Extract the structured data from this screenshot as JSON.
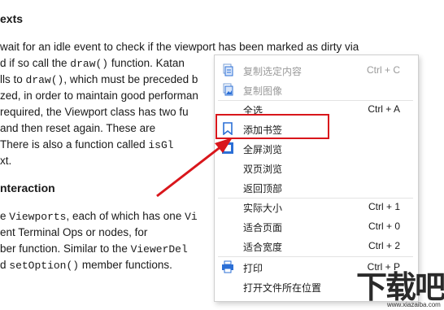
{
  "document": {
    "heading1": "exts",
    "para1": [
      " wait for an idle event to check if the viewport has been marked as dirty via",
      "d if so call the ",
      "draw()",
      " function. Katan",
      "lls to ",
      "draw()",
      ", which must be preceded b",
      "zed, in order to maintain good performan",
      " required, the Viewport class has two fu",
      " and then reset again. These are",
      " There is also a function called ",
      "isGl",
      "xt."
    ],
    "heading2": "nteraction",
    "para2": [
      "e ",
      "Viewports",
      ", each of which has one ",
      "Vi",
      "ent Terminal Ops or nodes, for",
      "ber function. Similar to the ",
      "ViewerDel",
      "d ",
      "setOption()",
      " member functions."
    ]
  },
  "menu": {
    "items": [
      {
        "label": "复制选定内容",
        "shortcut": "Ctrl + C",
        "icon": "copy-text-icon",
        "disabled": true
      },
      {
        "label": "复制图像",
        "shortcut": "",
        "icon": "copy-image-icon",
        "disabled": true
      },
      {
        "label": "全选",
        "shortcut": "Ctrl + A",
        "icon": "",
        "disabled": false
      },
      {
        "label": "添加书签",
        "shortcut": "",
        "icon": "bookmark-icon",
        "disabled": false
      },
      {
        "label": "全屏浏览",
        "shortcut": "",
        "icon": "fullscreen-icon",
        "disabled": false
      },
      {
        "label": "双页浏览",
        "shortcut": "",
        "icon": "",
        "disabled": false
      },
      {
        "label": "返回顶部",
        "shortcut": "",
        "icon": "",
        "disabled": false
      },
      {
        "label": "实际大小",
        "shortcut": "Ctrl + 1",
        "icon": "",
        "disabled": false
      },
      {
        "label": "适合页面",
        "shortcut": "Ctrl + 0",
        "icon": "",
        "disabled": false
      },
      {
        "label": "适合宽度",
        "shortcut": "Ctrl + 2",
        "icon": "",
        "disabled": false
      },
      {
        "label": "打印",
        "shortcut": "Ctrl + P",
        "icon": "print-icon",
        "disabled": false
      },
      {
        "label": "打开文件所在位置",
        "shortcut": "",
        "icon": "",
        "disabled": false
      }
    ]
  },
  "watermark": {
    "text": "下载吧",
    "url": "www.xiazaiba.com"
  },
  "colors": {
    "highlight": "#d9161b",
    "icon_blue": "#2b6fd6"
  }
}
